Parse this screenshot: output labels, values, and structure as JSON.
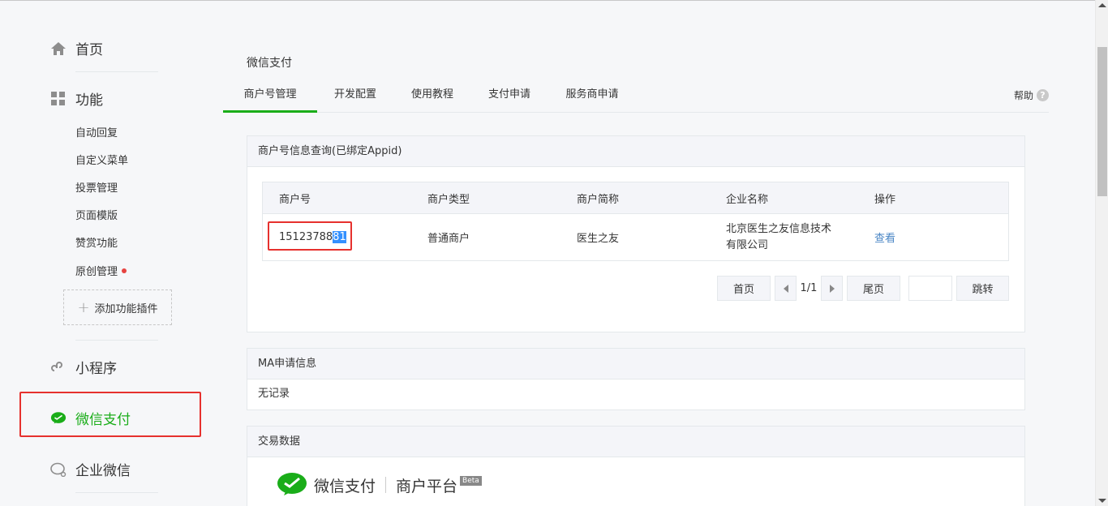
{
  "sidebar": {
    "home": "首页",
    "features": "功能",
    "feature_items": [
      "自动回复",
      "自定义菜单",
      "投票管理",
      "页面模版",
      "赞赏功能",
      "原创管理"
    ],
    "add_plugin": "添加功能插件",
    "miniprogram": "小程序",
    "wechat_pay": "微信支付",
    "work_wechat": "企业微信"
  },
  "page": {
    "title": "微信支付",
    "tabs": [
      "商户号管理",
      "开发配置",
      "使用教程",
      "支付申请",
      "服务商申请"
    ],
    "help": "帮助"
  },
  "merchant_panel": {
    "title": "商户号信息查询(已绑定Appid)",
    "columns": [
      "商户号",
      "商户类型",
      "商户简称",
      "企业名称",
      "操作"
    ],
    "row": {
      "merchant_id_prefix": "15123788",
      "merchant_id_selected": "81",
      "type": "普通商户",
      "short_name": "医生之友",
      "company": "北京医生之友信息技术有限公司",
      "action": "查看"
    },
    "pager": {
      "first": "首页",
      "page_info": "1/1",
      "last": "尾页",
      "jump": "跳转"
    }
  },
  "ma_panel": {
    "title": "MA申请信息",
    "content": "无记录"
  },
  "trade_panel": {
    "title": "交易数据",
    "logo_text": "微信支付",
    "logo_sub": "商户平台",
    "beta": "Beta"
  },
  "colors": {
    "accent_green": "#1aad19",
    "highlight_red": "#e6312e",
    "link_blue": "#4a86c5"
  }
}
